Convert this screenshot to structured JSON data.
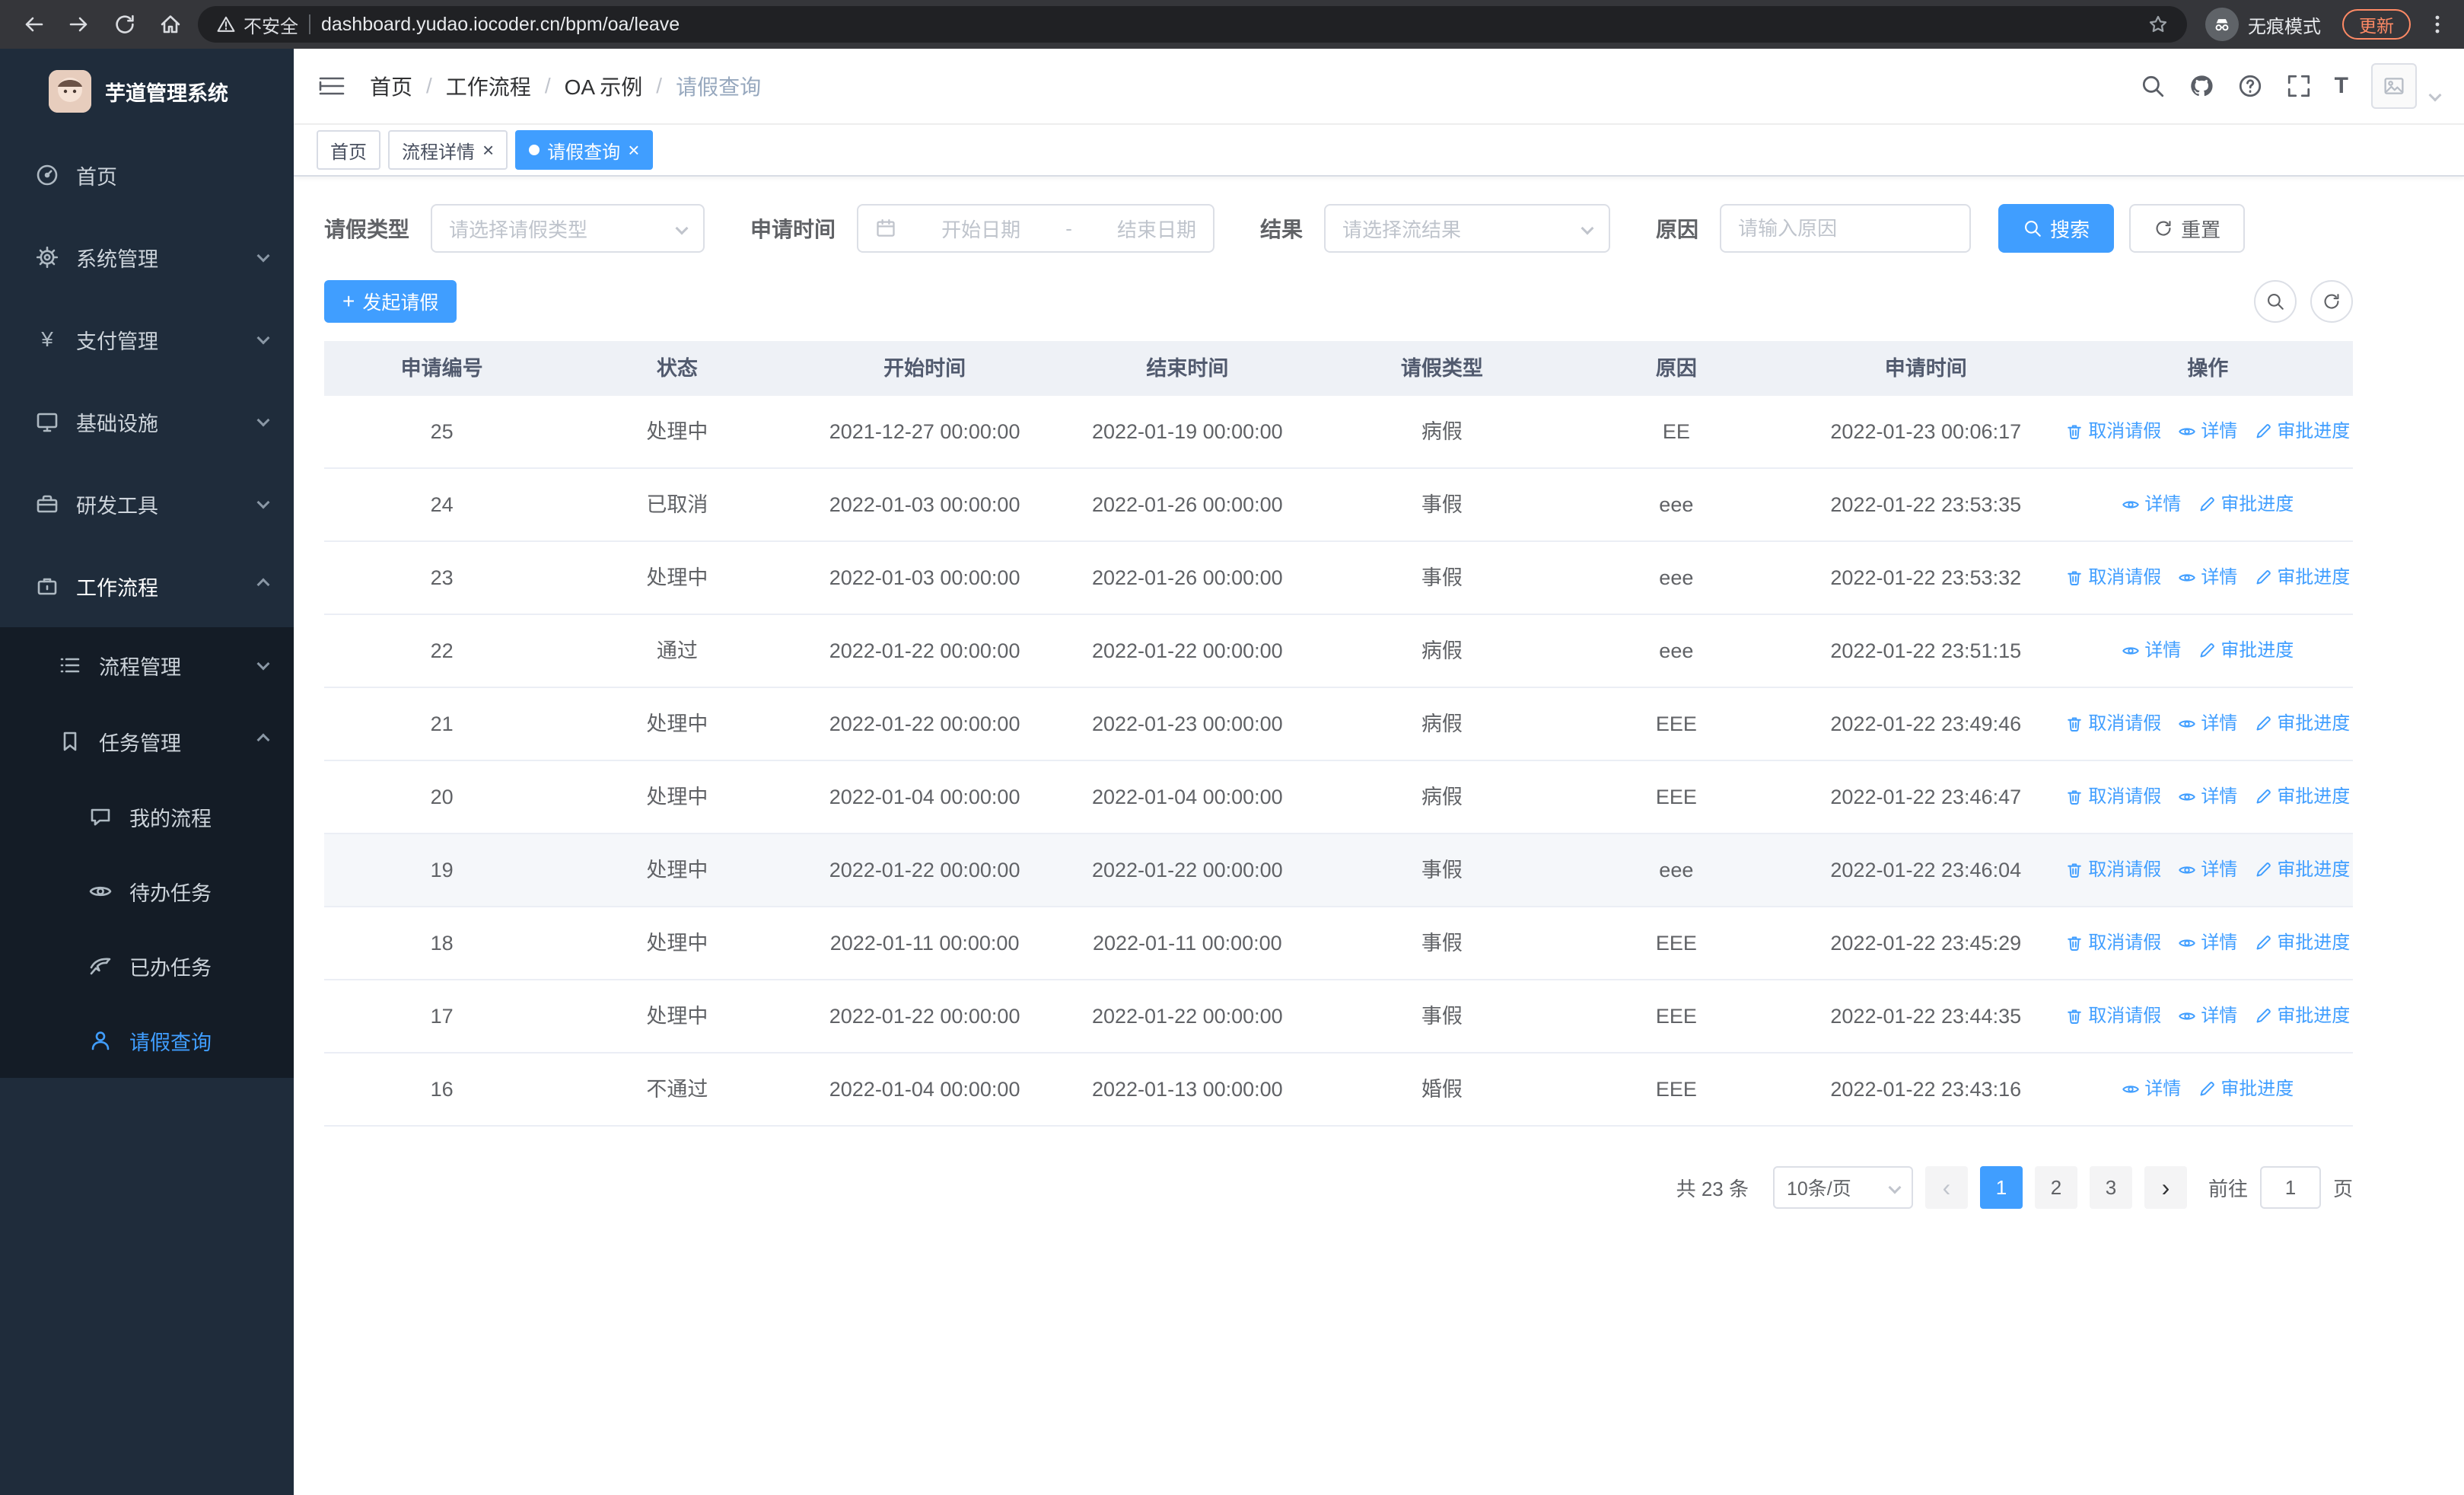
{
  "browser": {
    "security_label": "不安全",
    "url": "dashboard.yudao.iocoder.cn/bpm/oa/leave",
    "incognito_label": "无痕模式",
    "update_label": "更新"
  },
  "sidebar": {
    "logo_title": "芋道管理系统",
    "items": [
      {
        "label": "首页",
        "icon": "dashboard-icon"
      },
      {
        "label": "系统管理",
        "icon": "gear-icon"
      },
      {
        "label": "支付管理",
        "icon": "yen-icon"
      },
      {
        "label": "基础设施",
        "icon": "monitor-icon"
      },
      {
        "label": "研发工具",
        "icon": "toolbox-icon"
      },
      {
        "label": "工作流程",
        "icon": "briefcase-icon"
      }
    ],
    "workflow_children": [
      {
        "label": "流程管理",
        "icon": "list-icon"
      },
      {
        "label": "任务管理",
        "icon": "bookmark-icon"
      }
    ],
    "task_children": [
      {
        "label": "我的流程",
        "icon": "chat-icon"
      },
      {
        "label": "待办任务",
        "icon": "eye-icon"
      },
      {
        "label": "已办任务",
        "icon": "clipboard-check-icon"
      },
      {
        "label": "请假查询",
        "icon": "user-icon"
      }
    ]
  },
  "breadcrumb": {
    "items": [
      "首页",
      "工作流程",
      "OA 示例",
      "请假查询"
    ]
  },
  "tabs": [
    {
      "label": "首页"
    },
    {
      "label": "流程详情"
    },
    {
      "label": "请假查询"
    }
  ],
  "filters": {
    "leave_type_label": "请假类型",
    "leave_type_placeholder": "请选择请假类型",
    "apply_time_label": "申请时间",
    "start_placeholder": "开始日期",
    "separator": "-",
    "end_placeholder": "结束日期",
    "result_label": "结果",
    "result_placeholder": "请选择流结果",
    "reason_label": "原因",
    "reason_placeholder": "请输入原因",
    "search_label": "搜索",
    "reset_label": "重置"
  },
  "toolbar": {
    "create_label": "发起请假"
  },
  "table": {
    "headers": [
      "申请编号",
      "状态",
      "开始时间",
      "结束时间",
      "请假类型",
      "原因",
      "申请时间",
      "操作"
    ],
    "action_labels": {
      "cancel": "取消请假",
      "detail": "详情",
      "progress": "审批进度"
    },
    "rows": [
      {
        "id": "25",
        "status": "处理中",
        "start": "2021-12-27 00:00:00",
        "end": "2022-01-19 00:00:00",
        "type": "病假",
        "reason": "EE",
        "applied": "2022-01-23 00:06:17",
        "actions": [
          "cancel",
          "detail",
          "progress"
        ],
        "highlighted": false
      },
      {
        "id": "24",
        "status": "已取消",
        "start": "2022-01-03 00:00:00",
        "end": "2022-01-26 00:00:00",
        "type": "事假",
        "reason": "eee",
        "applied": "2022-01-22 23:53:35",
        "actions": [
          "detail",
          "progress"
        ],
        "highlighted": false
      },
      {
        "id": "23",
        "status": "处理中",
        "start": "2022-01-03 00:00:00",
        "end": "2022-01-26 00:00:00",
        "type": "事假",
        "reason": "eee",
        "applied": "2022-01-22 23:53:32",
        "actions": [
          "cancel",
          "detail",
          "progress"
        ],
        "highlighted": false
      },
      {
        "id": "22",
        "status": "通过",
        "start": "2022-01-22 00:00:00",
        "end": "2022-01-22 00:00:00",
        "type": "病假",
        "reason": "eee",
        "applied": "2022-01-22 23:51:15",
        "actions": [
          "detail",
          "progress"
        ],
        "highlighted": false
      },
      {
        "id": "21",
        "status": "处理中",
        "start": "2022-01-22 00:00:00",
        "end": "2022-01-23 00:00:00",
        "type": "病假",
        "reason": "EEE",
        "applied": "2022-01-22 23:49:46",
        "actions": [
          "cancel",
          "detail",
          "progress"
        ],
        "highlighted": false
      },
      {
        "id": "20",
        "status": "处理中",
        "start": "2022-01-04 00:00:00",
        "end": "2022-01-04 00:00:00",
        "type": "病假",
        "reason": "EEE",
        "applied": "2022-01-22 23:46:47",
        "actions": [
          "cancel",
          "detail",
          "progress"
        ],
        "highlighted": false
      },
      {
        "id": "19",
        "status": "处理中",
        "start": "2022-01-22 00:00:00",
        "end": "2022-01-22 00:00:00",
        "type": "事假",
        "reason": "eee",
        "applied": "2022-01-22 23:46:04",
        "actions": [
          "cancel",
          "detail",
          "progress"
        ],
        "highlighted": true
      },
      {
        "id": "18",
        "status": "处理中",
        "start": "2022-01-11 00:00:00",
        "end": "2022-01-11 00:00:00",
        "type": "事假",
        "reason": "EEE",
        "applied": "2022-01-22 23:45:29",
        "actions": [
          "cancel",
          "detail",
          "progress"
        ],
        "highlighted": false
      },
      {
        "id": "17",
        "status": "处理中",
        "start": "2022-01-22 00:00:00",
        "end": "2022-01-22 00:00:00",
        "type": "事假",
        "reason": "EEE",
        "applied": "2022-01-22 23:44:35",
        "actions": [
          "cancel",
          "detail",
          "progress"
        ],
        "highlighted": false
      },
      {
        "id": "16",
        "status": "不通过",
        "start": "2022-01-04 00:00:00",
        "end": "2022-01-13 00:00:00",
        "type": "婚假",
        "reason": "EEE",
        "applied": "2022-01-22 23:43:16",
        "actions": [
          "detail",
          "progress"
        ],
        "highlighted": false
      }
    ]
  },
  "pagination": {
    "total": "共 23 条",
    "page_size": "10条/页",
    "prev": "‹",
    "next": "›",
    "pages": [
      "1",
      "2",
      "3"
    ],
    "active_page": "1",
    "goto_label": "前往",
    "goto_value": "1",
    "page_unit": "页"
  },
  "colors": {
    "primary": "#409eff",
    "sidebar_bg": "#1f2c3b",
    "submenu_bg": "#141c26"
  }
}
